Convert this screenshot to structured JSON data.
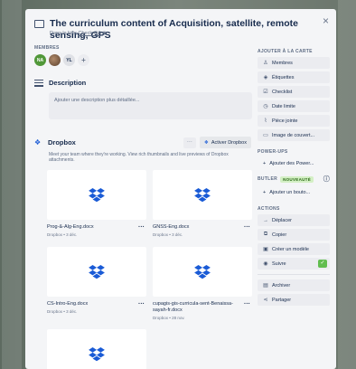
{
  "card": {
    "title": "The curriculum content of Acquisition, satellite, remote sensing, GPS",
    "list_prefix": "Dans la liste",
    "list_name": "Check-QA",
    "close_label": "×",
    "watch_icon": "eye-icon"
  },
  "members": {
    "label": "MEMBRES",
    "avatars": [
      "NA",
      "",
      "YL"
    ],
    "add_label": "+"
  },
  "description": {
    "title": "Description",
    "placeholder": "Ajouter une description plus détaillée..."
  },
  "dropbox": {
    "title": "Dropbox",
    "more_label": "···",
    "activate_label": "Activer Dropbox",
    "info": "Meet your team where they're working. View rich thumbnails and live previews of Dropbox attachments.",
    "files": [
      {
        "name": "Prog-&-Alg-Eng.docx",
        "meta": "Dropbox • 3 déc."
      },
      {
        "name": "GNSS-Eng.docx",
        "meta": "Dropbox • 3 déc."
      },
      {
        "name": "CS-Intro-Eng.docx",
        "meta": "Dropbox • 3 déc."
      },
      {
        "name": "cupagis-gis-curricula-sent-Benaissa-sayah-fr.docx",
        "meta": "Dropbox • 28 nov."
      }
    ]
  },
  "sidebar": {
    "add_to_card_label": "AJOUTER À LA CARTE",
    "add_items": [
      "Membres",
      "Étiquettes",
      "Checklist",
      "Date limite",
      "Pièce jointe",
      "Image de couvert..."
    ],
    "powerups_label": "POWER-UPS",
    "powerups_add": "Ajouter des Power...",
    "butler_label": "BUTLER",
    "butler_badge": "NOUVEAUTÉ",
    "butler_add": "Ajouter un bouto...",
    "actions_label": "ACTIONS",
    "actions": [
      "Déplacer",
      "Copier",
      "Créer un modèle",
      "Suivre",
      "Archiver",
      "Partager"
    ],
    "follow_check": "✓"
  },
  "colors": {
    "accent": "#1a5bd6",
    "member_green": "#519839",
    "toggle_green": "#61bd4f"
  }
}
